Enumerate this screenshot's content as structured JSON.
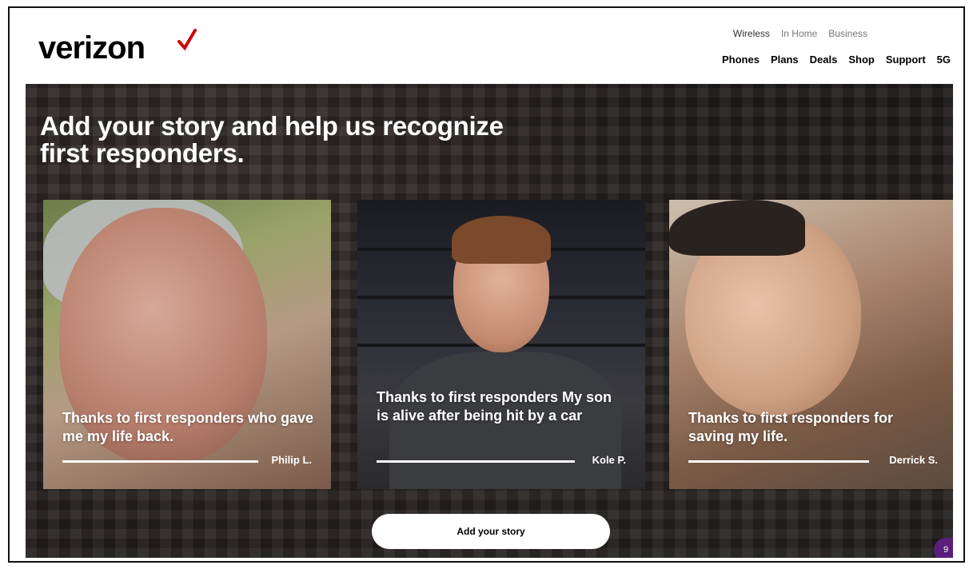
{
  "brand": {
    "name": "verizon",
    "accent_color": "#cd040b"
  },
  "top_nav": [
    "Wireless",
    "In Home",
    "Business"
  ],
  "main_nav": [
    "Phones",
    "Plans",
    "Deals",
    "Shop",
    "Support",
    "5G"
  ],
  "hero": {
    "title": "Add your story and help us recognize first responders.",
    "cards": [
      {
        "quote": "Thanks to first responders who gave me my life back.",
        "author": "Philip L."
      },
      {
        "quote": "Thanks to first responders My son is alive after being hit by a car",
        "author": "Kole P."
      },
      {
        "quote": "Thanks to first responders for saving my life.",
        "author": "Derrick S."
      }
    ],
    "cta_label": "Add your story"
  },
  "badge": "9"
}
